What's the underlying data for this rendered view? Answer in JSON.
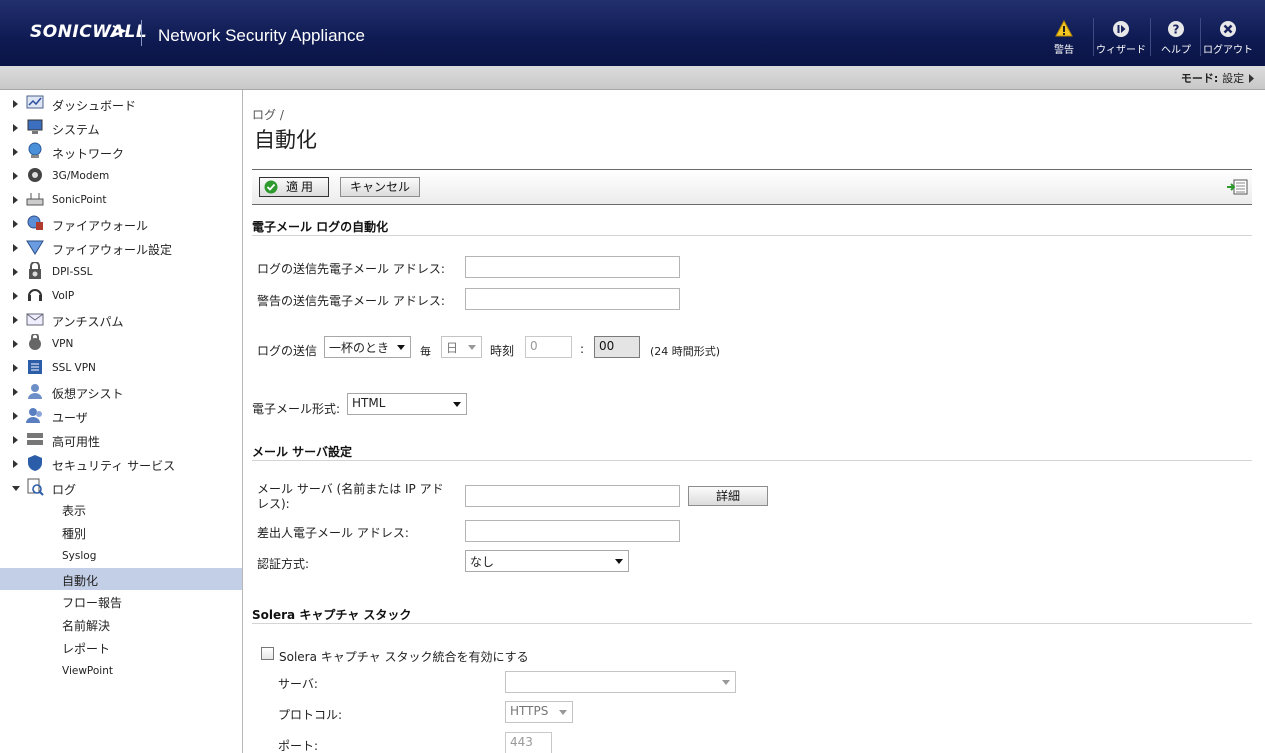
{
  "header": {
    "logo": "SONICWALL",
    "app_title": "Network Security Appliance",
    "buttons": [
      {
        "label": "警告",
        "icon": "warning-icon"
      },
      {
        "label": "ウィザード",
        "icon": "wizard-icon"
      },
      {
        "label": "ヘルプ",
        "icon": "help-icon"
      },
      {
        "label": "ログアウト",
        "icon": "logout-icon"
      }
    ]
  },
  "modebar": {
    "mode_label": "モード:",
    "mode_value": "設定"
  },
  "sidebar": {
    "items": [
      {
        "label": "ダッシュボード",
        "icon": "dashboard-icon"
      },
      {
        "label": "システム",
        "icon": "system-icon"
      },
      {
        "label": "ネットワーク",
        "icon": "network-icon"
      },
      {
        "label": "3G/Modem",
        "icon": "modem-icon"
      },
      {
        "label": "SonicPoint",
        "icon": "sonicpoint-icon"
      },
      {
        "label": "ファイアウォール",
        "icon": "firewall-icon"
      },
      {
        "label": "ファイアウォール設定",
        "icon": "firewall-settings-icon"
      },
      {
        "label": "DPI-SSL",
        "icon": "dpi-ssl-icon"
      },
      {
        "label": "VoIP",
        "icon": "voip-icon"
      },
      {
        "label": "アンチスパム",
        "icon": "antispam-icon"
      },
      {
        "label": "VPN",
        "icon": "vpn-icon"
      },
      {
        "label": "SSL VPN",
        "icon": "ssl-vpn-icon"
      },
      {
        "label": "仮想アシスト",
        "icon": "virtual-assist-icon"
      },
      {
        "label": "ユーザ",
        "icon": "users-icon"
      },
      {
        "label": "高可用性",
        "icon": "high-availability-icon"
      },
      {
        "label": "セキュリティ サービス",
        "icon": "security-services-icon"
      },
      {
        "label": "ログ",
        "icon": "log-icon"
      }
    ],
    "log_sub": [
      "表示",
      "種別",
      "Syslog",
      "自動化",
      "フロー報告",
      "名前解決",
      "レポート",
      "ViewPoint"
    ]
  },
  "main": {
    "breadcrumb": "ログ /",
    "title": "自動化",
    "apply_label": "適用",
    "cancel_label": "キャンセル",
    "email_section": "電子メール ログの自動化",
    "log_to_label": "ログの送信先電子メール アドレス:",
    "alert_to_label": "警告の送信先電子メール アドレス:",
    "send_log_label": "ログの送信",
    "send_when": "一杯のとき",
    "every_label": "毎",
    "day_value": "日",
    "time_label": "時刻",
    "hour_value": "0",
    "colon": ":",
    "minute_value": "00",
    "time_format_note": "(24 時間形式)",
    "email_format_label": "電子メール形式:",
    "email_format_value": "HTML",
    "mail_server_section": "メール サーバ設定",
    "mail_server_label": "メール サーバ (名前または IP アドレス):",
    "detail_button": "詳細",
    "from_label": "差出人電子メール アドレス:",
    "auth_label": "認証方式:",
    "auth_value": "なし",
    "solera_section": "Solera キャプチャ スタック",
    "solera_enable_label": "Solera キャプチャ スタック統合を有効にする",
    "server_label": "サーバ:",
    "protocol_label": "プロトコル:",
    "protocol_value": "HTTPS",
    "port_label": "ポート:",
    "port_value": "443"
  },
  "colors": {
    "header_bg": "#0e1a52",
    "active_nav": "#c3cfe6",
    "accent_green": "#2e9a2e"
  }
}
